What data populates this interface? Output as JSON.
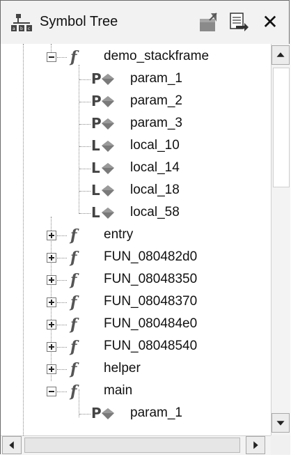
{
  "title": "Symbol Tree",
  "toolbar": {
    "icons": [
      "create-namespace-icon",
      "navigate-icon",
      "close-icon"
    ],
    "close_glyph": "✕"
  },
  "tree": {
    "demo_stackframe": {
      "label": "demo_stackframe",
      "children": [
        {
          "kind": "P",
          "label": "param_1"
        },
        {
          "kind": "P",
          "label": "param_2"
        },
        {
          "kind": "P",
          "label": "param_3"
        },
        {
          "kind": "L",
          "label": "local_10"
        },
        {
          "kind": "L",
          "label": "local_14"
        },
        {
          "kind": "L",
          "label": "local_18"
        },
        {
          "kind": "L",
          "label": "local_58"
        }
      ]
    },
    "functions": [
      {
        "label": "entry"
      },
      {
        "label": "FUN_080482d0"
      },
      {
        "label": "FUN_08048350"
      },
      {
        "label": "FUN_08048370"
      },
      {
        "label": "FUN_080484e0"
      },
      {
        "label": "FUN_08048540"
      },
      {
        "label": "helper"
      }
    ],
    "main": {
      "label": "main",
      "children": [
        {
          "kind": "P",
          "label": "param_1"
        }
      ]
    }
  },
  "icon_glyphs": {
    "function": "f"
  },
  "colors": {
    "parameter_letter": "#444444",
    "diamond": "#7a7a7a"
  }
}
